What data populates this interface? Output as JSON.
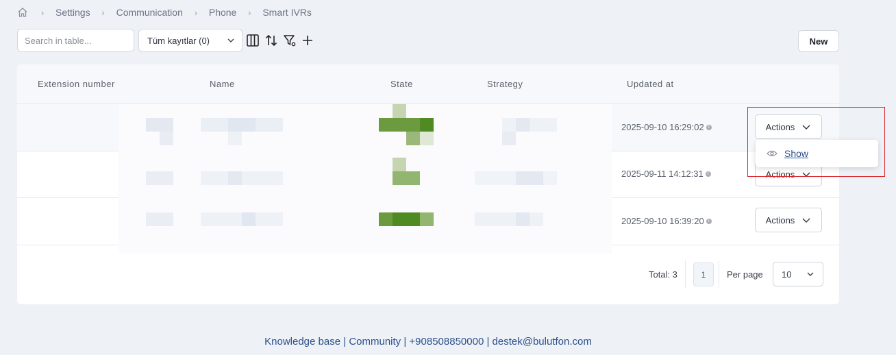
{
  "breadcrumb": {
    "items": [
      "Settings",
      "Communication",
      "Phone",
      "Smart IVRs"
    ]
  },
  "toolbar": {
    "search_placeholder": "Search in table...",
    "filter_value": "Tüm kayıtlar (0)",
    "new_label": "New"
  },
  "table": {
    "columns": [
      "Extension number",
      "Name",
      "State",
      "Strategy",
      "Updated at"
    ],
    "rows": [
      {
        "updated_at": "2025-09-10 16:29:02",
        "actions": "Actions"
      },
      {
        "updated_at": "2025-09-11 14:12:31",
        "actions": "Actions"
      },
      {
        "updated_at": "2025-09-10 16:39:20",
        "actions": "Actions"
      }
    ]
  },
  "dropdown": {
    "show_label": "Show"
  },
  "pagination": {
    "total_label": "Total: 3",
    "current_page": "1",
    "per_page_label": "Per page",
    "per_page_value": "10"
  },
  "footer": {
    "knowledge": "Knowledge base",
    "community": "Community",
    "phone": "+908508850000",
    "email": "destek@bulutfon.com",
    "separator": "|"
  },
  "colors": {
    "accent": "#2c4f8a",
    "highlight_border": "#d9262f",
    "background": "#eef2f7",
    "state_green": "#6a9a3a"
  }
}
